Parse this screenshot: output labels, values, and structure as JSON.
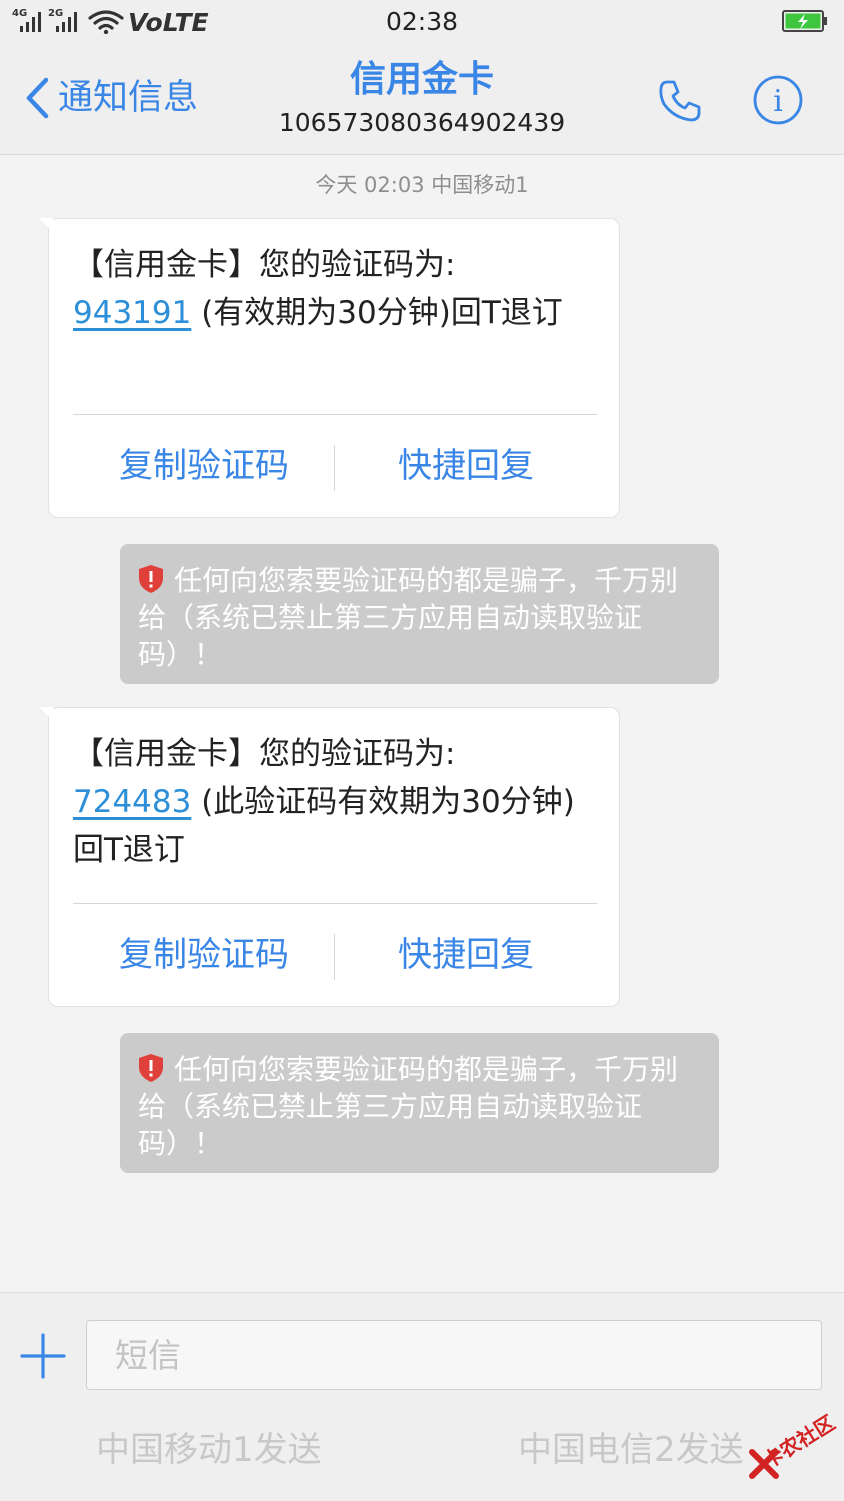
{
  "status_bar": {
    "sim1_tag": "4G",
    "sim2_tag": "2G",
    "network_label": "VoLTE",
    "time": "02:38",
    "battery_color": "#3ec73e"
  },
  "header": {
    "back_label": "通知信息",
    "contact_name": "信用金卡",
    "contact_number": "106573080364902439",
    "accent_color": "#3a86e6"
  },
  "conversation": {
    "date_stamp": "今天 02:03  中国移动1",
    "messages": [
      {
        "text_before": "【信用金卡】您的验证码为:",
        "code": "943191",
        "text_after": " (有效期为30分钟)回T退订",
        "copy_label": "复制验证码",
        "reply_label": "快捷回复",
        "warning": "任何向您索要验证码的都是骗子，千万别给（系统已禁止第三方应用自动读取验证码）！"
      },
      {
        "text_before": "【信用金卡】您的验证码为:",
        "code": "724483",
        "text_after": " (此验证码有效期为30分钟)回T退订",
        "copy_label": "复制验证码",
        "reply_label": "快捷回复",
        "warning": "任何向您索要验证码的都是骗子，千万别给（系统已禁止第三方应用自动读取验证码）！"
      }
    ]
  },
  "compose": {
    "placeholder": "短信",
    "send_sim1_label": "中国移动1发送",
    "send_sim2_label": "中国电信2发送"
  },
  "watermark": {
    "text": "卡农社区"
  }
}
